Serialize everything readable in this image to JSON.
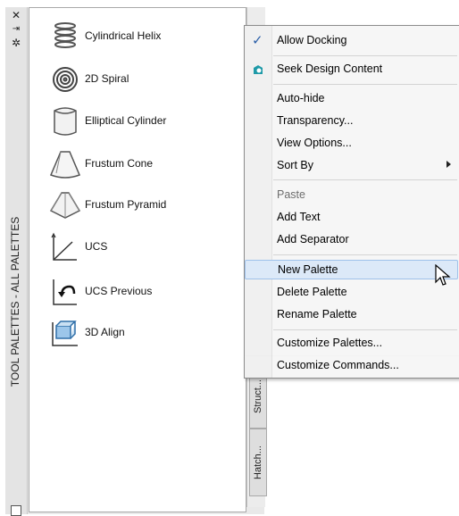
{
  "palette": {
    "title": "TOOL PALETTES - ALL PALETTES",
    "tools": [
      {
        "label": "Cylindrical Helix",
        "icon": "helix-icon"
      },
      {
        "label": "2D Spiral",
        "icon": "spiral-icon"
      },
      {
        "label": "Elliptical Cylinder",
        "icon": "elliptical-cylinder-icon"
      },
      {
        "label": "Frustum Cone",
        "icon": "frustum-cone-icon"
      },
      {
        "label": "Frustum Pyramid",
        "icon": "frustum-pyramid-icon"
      },
      {
        "label": "UCS",
        "icon": "ucs-icon"
      },
      {
        "label": "UCS Previous",
        "icon": "ucs-previous-icon"
      },
      {
        "label": "3D Align",
        "icon": "3d-align-icon"
      }
    ],
    "tabs": [
      "Struct...",
      "Hatch..."
    ]
  },
  "menu": {
    "items": [
      {
        "label": "Allow Docking",
        "checked": true
      },
      {
        "label": "Seek Design Content",
        "icon": "seek-icon"
      },
      {
        "label": "Auto-hide"
      },
      {
        "label": "Transparency..."
      },
      {
        "label": "View Options..."
      },
      {
        "label": "Sort By",
        "submenu": true
      },
      {
        "label": "Paste",
        "disabled": true
      },
      {
        "label": "Add Text"
      },
      {
        "label": "Add Separator"
      },
      {
        "label": "New Palette",
        "highlighted": true
      },
      {
        "label": "Delete Palette"
      },
      {
        "label": "Rename Palette"
      },
      {
        "label": "Customize Palettes..."
      },
      {
        "label": "Customize Commands..."
      }
    ]
  },
  "colors": {
    "highlight": "#dce9f8",
    "check": "#2b5fa8"
  }
}
